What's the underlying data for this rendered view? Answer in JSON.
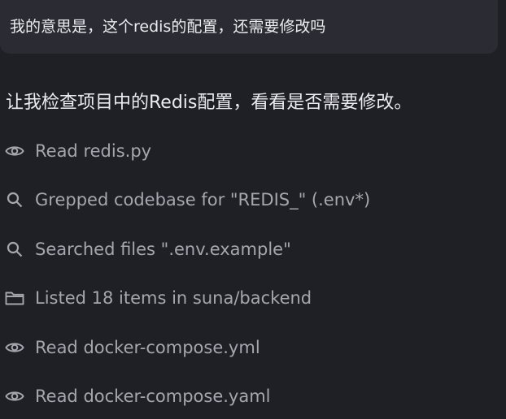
{
  "user_message": {
    "text": "我的意思是，这个redis的配置，还需要修改吗"
  },
  "assistant_message": {
    "text": "让我检查项目中的Redis配置，看看是否需要修改。"
  },
  "actions": [
    {
      "icon": "eye-icon",
      "label": "Read redis.py"
    },
    {
      "icon": "search-icon",
      "label": "Grepped codebase for \"REDIS_\" (.env*)"
    },
    {
      "icon": "search-icon",
      "label": "Searched files \".env.example\""
    },
    {
      "icon": "folder-icon",
      "label": "Listed 18 items in suna/backend"
    },
    {
      "icon": "eye-icon",
      "label": "Read docker-compose.yml"
    },
    {
      "icon": "eye-icon",
      "label": "Read docker-compose.yaml"
    }
  ]
}
